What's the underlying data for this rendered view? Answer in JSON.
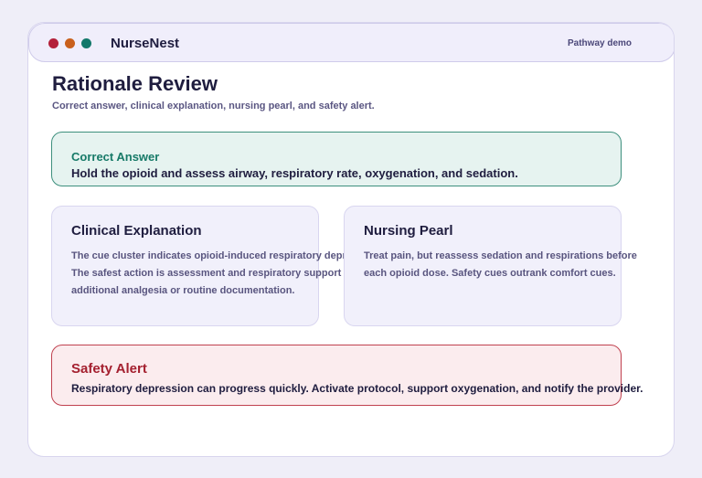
{
  "app": {
    "name": "NurseNest",
    "mode_label": "Pathway demo"
  },
  "page": {
    "title": "Rationale Review",
    "subtitle": "Correct answer, clinical explanation, nursing pearl, and safety alert."
  },
  "correct_answer": {
    "label": "Correct Answer",
    "text": "Hold the opioid and assess airway, respiratory rate, oxygenation, and sedation."
  },
  "clinical_explanation": {
    "heading": "Clinical Explanation",
    "lines": [
      "The cue cluster indicates opioid-induced respiratory depression.",
      "The safest action is assessment and respiratory support before",
      "additional analgesia or routine documentation."
    ]
  },
  "nursing_pearl": {
    "heading": "Nursing Pearl",
    "lines": [
      "Treat pain, but reassess sedation and respirations before",
      "each opioid dose. Safety cues outrank comfort cues."
    ]
  },
  "safety_alert": {
    "label": "Safety Alert",
    "text": "Respiratory depression can progress quickly. Activate protocol, support oxygenation, and notify the provider."
  },
  "colors": {
    "background": "#efeef8",
    "accent_teal": "#177a68",
    "alert_red": "#a4202f",
    "dot_red": "#b3203a",
    "dot_orange": "#c9601c",
    "dot_teal": "#13786a"
  }
}
